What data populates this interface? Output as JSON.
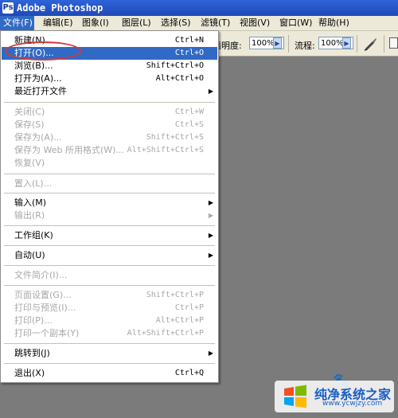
{
  "window": {
    "title": "Adobe Photoshop",
    "icon_letter": "Ps"
  },
  "menubar": {
    "items": [
      {
        "label": "文件(F)"
      },
      {
        "label": "编辑(E)"
      },
      {
        "label": "图象(I)"
      },
      {
        "label": "图层(L)"
      },
      {
        "label": "选择(S)"
      },
      {
        "label": "滤镜(T)"
      },
      {
        "label": "视图(V)"
      },
      {
        "label": "窗口(W)"
      },
      {
        "label": "帮助(H)"
      }
    ]
  },
  "options": {
    "opacity_label": "不透明度:",
    "opacity_value": "100%",
    "flow_label": "流程:",
    "flow_value": "100%",
    "arrow_glyph": "▶"
  },
  "file_menu": {
    "submenu_arrow": "▶",
    "items": [
      {
        "label": "新建(N)...",
        "shortcut": "Ctrl+N"
      },
      {
        "label": "打开(O)...",
        "shortcut": "Ctrl+O"
      },
      {
        "label": "浏览(B)...",
        "shortcut": "Shift+Ctrl+O"
      },
      {
        "label": "打开为(A)...",
        "shortcut": "Alt+Ctrl+O"
      },
      {
        "label": "最近打开文件",
        "shortcut": ""
      },
      {
        "label": "关闭(C)",
        "shortcut": "Ctrl+W"
      },
      {
        "label": "保存(S)",
        "shortcut": "Ctrl+S"
      },
      {
        "label": "保存为(A)...",
        "shortcut": "Shift+Ctrl+S"
      },
      {
        "label": "保存为 Web 所用格式(W)...",
        "shortcut": "Alt+Shift+Ctrl+S"
      },
      {
        "label": "恢复(V)",
        "shortcut": ""
      },
      {
        "label": "置入(L)...",
        "shortcut": ""
      },
      {
        "label": "输入(M)",
        "shortcut": ""
      },
      {
        "label": "输出(R)",
        "shortcut": ""
      },
      {
        "label": "工作组(K)",
        "shortcut": ""
      },
      {
        "label": "自动(U)",
        "shortcut": ""
      },
      {
        "label": "文件简介(I)...",
        "shortcut": ""
      },
      {
        "label": "页面设置(G)...",
        "shortcut": "Shift+Ctrl+P"
      },
      {
        "label": "打印与预览(I)...",
        "shortcut": "Ctrl+P"
      },
      {
        "label": "打印(P)...",
        "shortcut": "Alt+Ctrl+P"
      },
      {
        "label": "打印一个副本(Y)",
        "shortcut": "Alt+Shift+Ctrl+P"
      },
      {
        "label": "跳转到(J)",
        "shortcut": ""
      },
      {
        "label": "退出(X)",
        "shortcut": "Ctrl+Q"
      }
    ]
  },
  "watermark": {
    "name": "纯净系统之家",
    "url": "www.ycwjzy.com"
  },
  "colors": {
    "selection": "#316ac5",
    "annotation": "#d23a3a",
    "titlebar": "#2f63d8"
  }
}
